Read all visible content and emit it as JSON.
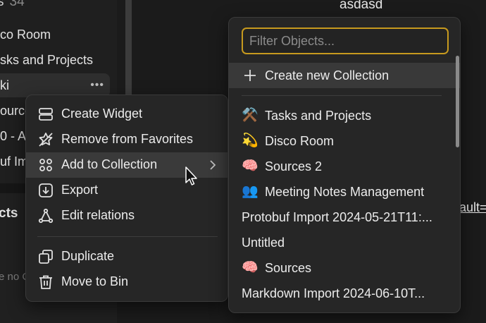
{
  "sidebar": {
    "header_title": "s",
    "header_count": "34",
    "items": [
      {
        "label": "co Room"
      },
      {
        "label": "sks and Projects"
      },
      {
        "label": "ki"
      },
      {
        "label": "ource"
      },
      {
        "label": "0 - A"
      },
      {
        "label": "uf Im"
      }
    ],
    "item_more": "•••",
    "card_title": "cts",
    "card_subtitle": "e no C"
  },
  "main": {
    "title": "asdasd",
    "link_fragment": "ault="
  },
  "context_menu": {
    "items": [
      {
        "label": "Create Widget",
        "icon": "widget-icon"
      },
      {
        "label": "Remove from Favorites",
        "icon": "unstar-icon"
      },
      {
        "label": "Add to Collection",
        "icon": "collection-icon",
        "hovered": true
      },
      {
        "label": "Export",
        "icon": "export-icon"
      },
      {
        "label": "Edit relations",
        "icon": "relations-icon"
      },
      {
        "label": "Duplicate",
        "icon": "duplicate-icon"
      },
      {
        "label": "Move to Bin",
        "icon": "bin-icon"
      }
    ]
  },
  "collection_menu": {
    "filter_placeholder": "Filter Objects...",
    "create_label": "Create new Collection",
    "items": [
      {
        "emoji": "⚒️",
        "label": "Tasks and Projects"
      },
      {
        "emoji": "💫",
        "label": "Disco Room"
      },
      {
        "emoji": "🧠",
        "label": "Sources 2"
      },
      {
        "emoji": "👥",
        "label": "Meeting Notes Management"
      },
      {
        "emoji": "",
        "label": "Protobuf Import 2024-05-21T11:..."
      },
      {
        "emoji": "",
        "label": "Untitled"
      },
      {
        "emoji": "🧠",
        "label": "Sources"
      },
      {
        "emoji": "",
        "label": "Markdown Import 2024-06-10T..."
      }
    ]
  },
  "colors": {
    "background": "#1b1b1b",
    "menu": "#262626",
    "hover": "#3a3a3a",
    "filter_border": "#c79a1e"
  }
}
